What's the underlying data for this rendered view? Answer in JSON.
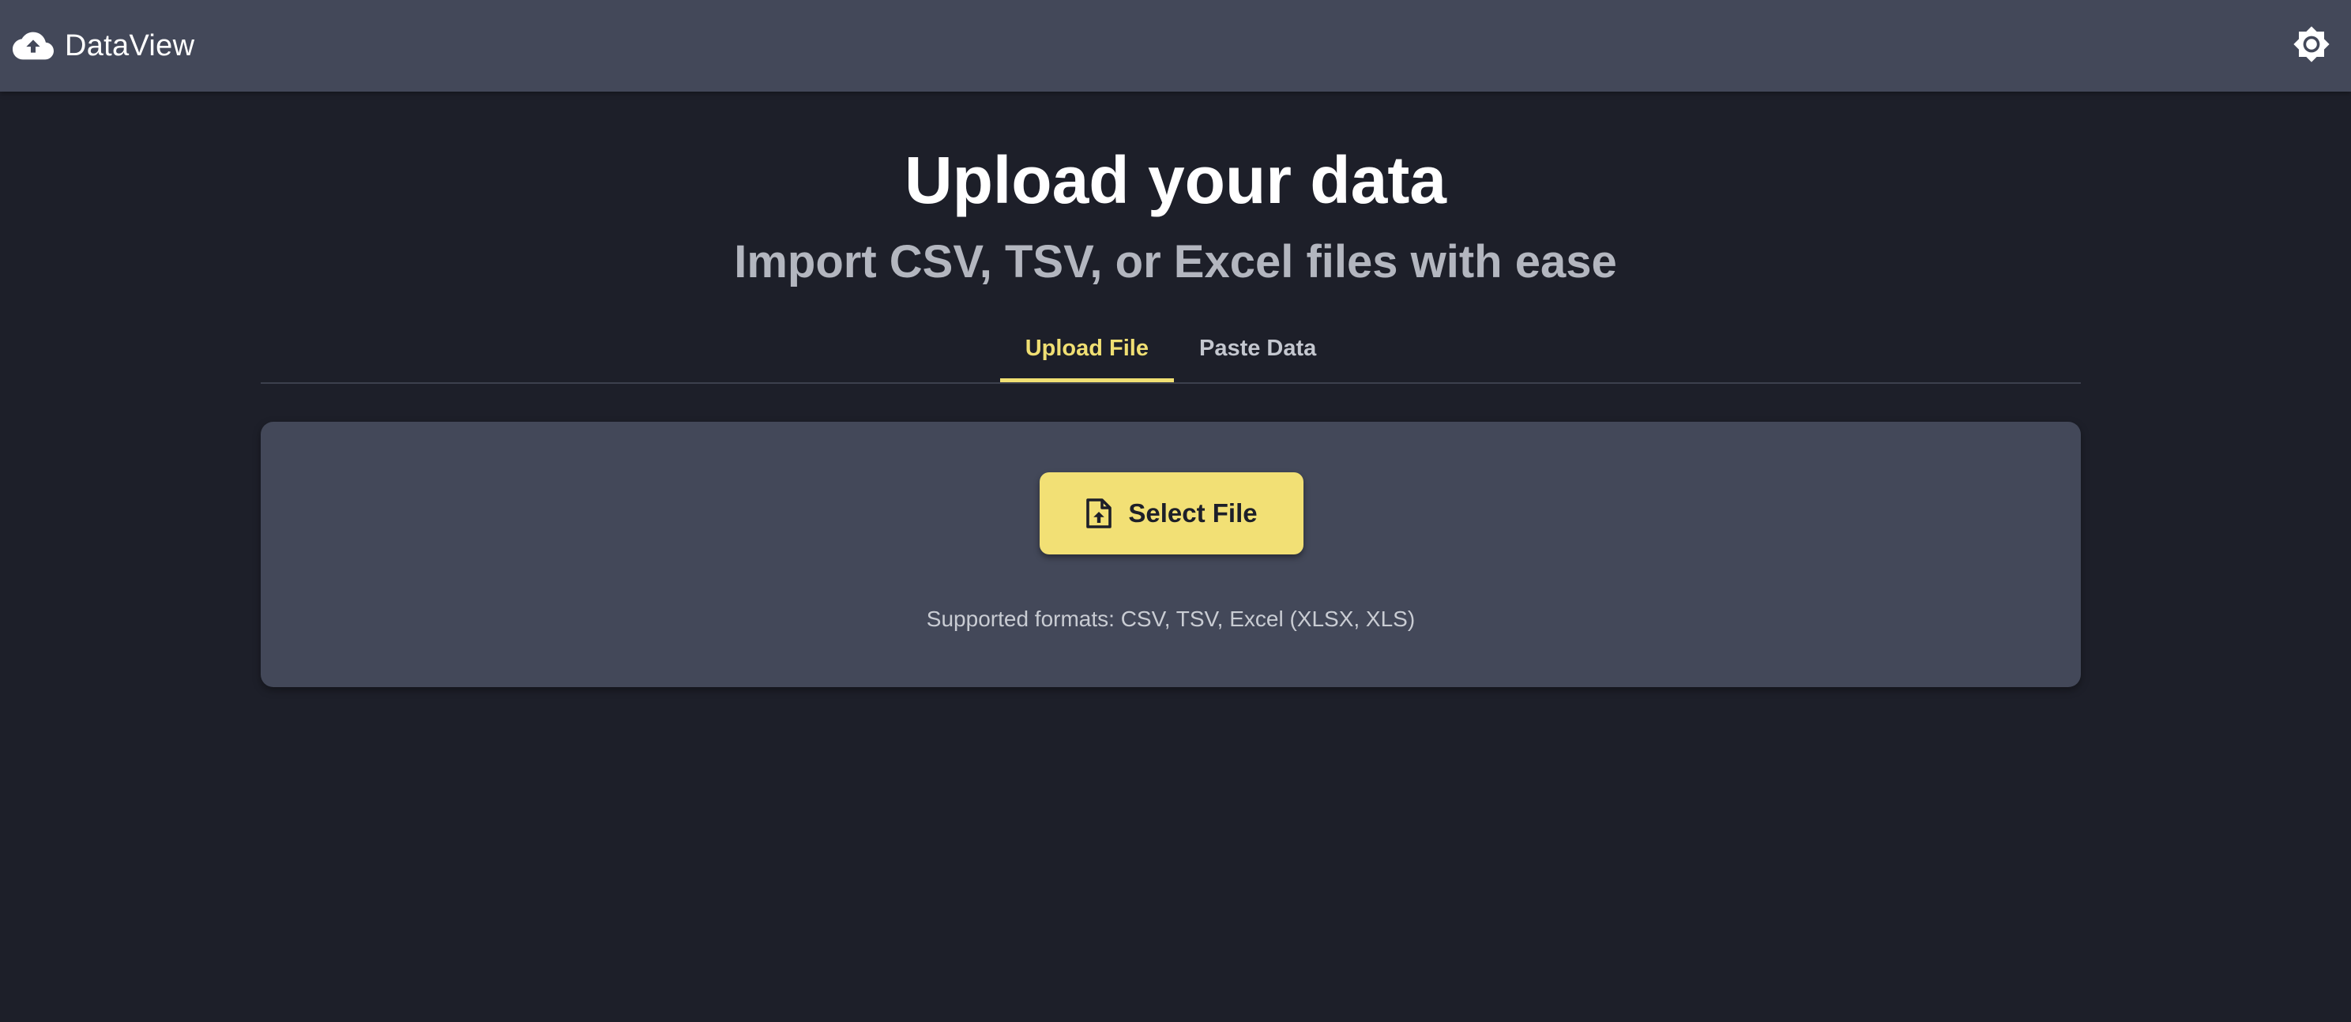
{
  "app": {
    "name": "DataView",
    "logo_icon": "cloud-upload-icon",
    "theme_toggle_icon": "brightness-icon"
  },
  "hero": {
    "title": "Upload your data",
    "subtitle": "Import CSV, TSV, or Excel files with ease"
  },
  "tabs": [
    {
      "label": "Upload File",
      "active": true
    },
    {
      "label": "Paste Data",
      "active": false
    }
  ],
  "upload": {
    "button_label": "Select File",
    "button_icon": "file-upload-icon",
    "supported_formats": "Supported formats: CSV, TSV, Excel (XLSX, XLS)"
  },
  "colors": {
    "background": "#1d1f29",
    "surface": "#434859",
    "accent": "#f2e075",
    "text_muted": "#b3b6bf"
  }
}
